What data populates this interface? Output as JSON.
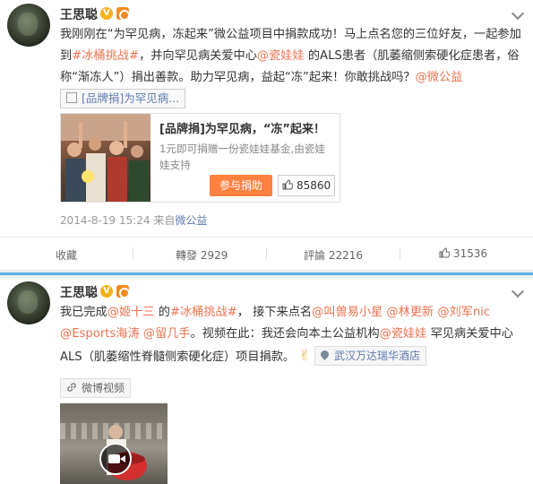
{
  "post1": {
    "user": "王思聪",
    "text": {
      "p1": "我刚刚在“为罕见病，冻起来”微公益项目中捐款成功！马上点名您的三位好友，一起参加到",
      "hashtag": "#冰桶挑战#",
      "p2": "，并向罕见病关爱中心",
      "mention": "@瓷娃娃",
      "p3": " 的ALS患者（肌萎缩侧索硬化症患者，俗称“渐冻人”）捐出善款。助力罕见病，益起“冻”起来！你敢挑战吗？",
      "mention2": "@微公益",
      "tag": "[品牌捐]为罕见病..."
    },
    "card": {
      "title": "[品牌捐]为罕见病，“冻”起来！",
      "desc": "1元即可捐赠一份瓷娃娃基金,由瓷娃娃支持",
      "button": "参与捐助",
      "likes": "85860"
    },
    "meta": {
      "time": "2014-8-19 15:24",
      "from": "来自",
      "source": "微公益"
    },
    "actions": {
      "favorite": "收藏",
      "repost_label": "轉發",
      "repost_count": "2929",
      "comment_label": "評論",
      "comment_count": "22216",
      "like_count": "31536"
    }
  },
  "post2": {
    "user": "王思聪",
    "text": {
      "p1": "我已完成",
      "m1": "@姬十三",
      "p2": " 的",
      "hashtag": "#冰桶挑战#",
      "p3": "， 接下来点名",
      "m2": "@叫兽易小星",
      "m3": "@林更新",
      "m4": "@刘军nic",
      "m5": "@Esports海涛",
      "m6": "@留几手",
      "p4": "。视频在此：我还会向本土公益机构",
      "m7": "@瓷娃娃",
      "p5": " 罕见病关爱中心ALS（肌萎缩性脊髓侧索硬化症）项目捐款。",
      "emoji": "✌",
      "location": "武汉万达瑞华酒店",
      "video_tag": "微博视频"
    }
  },
  "colors": {
    "link": "#eb7350",
    "accent_blue": "#5d7bb0",
    "button": "#ff8140",
    "divider": "#5ab0e6"
  }
}
